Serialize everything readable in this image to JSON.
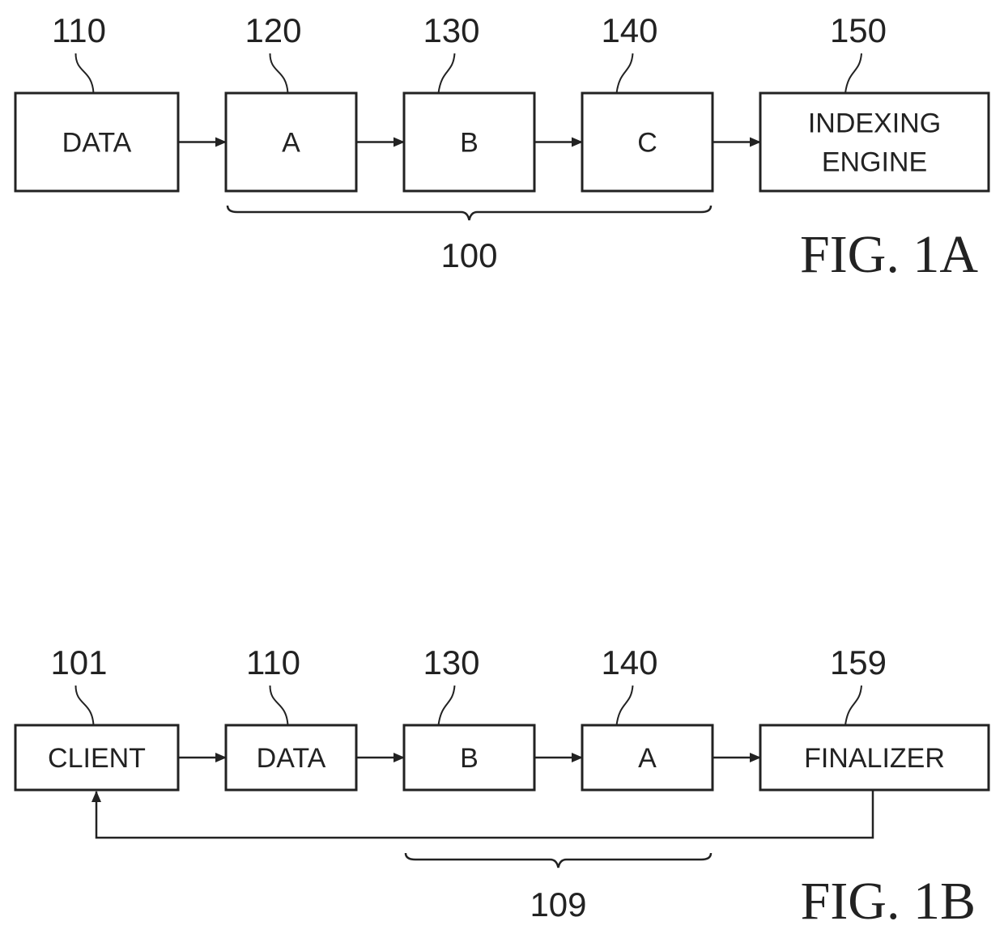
{
  "figures": [
    {
      "id": "fig-1a",
      "caption": "FIG. 1A",
      "blocks": [
        {
          "ref": "110",
          "lines": [
            "DATA"
          ]
        },
        {
          "ref": "120",
          "lines": [
            "A"
          ]
        },
        {
          "ref": "130",
          "lines": [
            "B"
          ]
        },
        {
          "ref": "140",
          "lines": [
            "C"
          ]
        },
        {
          "ref": "150",
          "lines": [
            "INDEXING",
            "ENGINE"
          ]
        }
      ],
      "connections": [
        [
          "110",
          "120"
        ],
        [
          "120",
          "130"
        ],
        [
          "130",
          "140"
        ],
        [
          "140",
          "150"
        ]
      ],
      "brace": {
        "ref": "100",
        "spans": [
          "120",
          "140"
        ]
      }
    },
    {
      "id": "fig-1b",
      "caption": "FIG. 1B",
      "blocks": [
        {
          "ref": "101",
          "lines": [
            "CLIENT"
          ]
        },
        {
          "ref": "110",
          "lines": [
            "DATA"
          ]
        },
        {
          "ref": "130",
          "lines": [
            "B"
          ]
        },
        {
          "ref": "140",
          "lines": [
            "A"
          ]
        },
        {
          "ref": "159",
          "lines": [
            "FINALIZER"
          ]
        }
      ],
      "connections": [
        [
          "101",
          "110"
        ],
        [
          "110",
          "130"
        ],
        [
          "130",
          "140"
        ],
        [
          "140",
          "159"
        ]
      ],
      "feedback": {
        "from": "159",
        "to": "101"
      },
      "brace": {
        "ref": "109",
        "spans": [
          "130",
          "140"
        ]
      }
    }
  ]
}
